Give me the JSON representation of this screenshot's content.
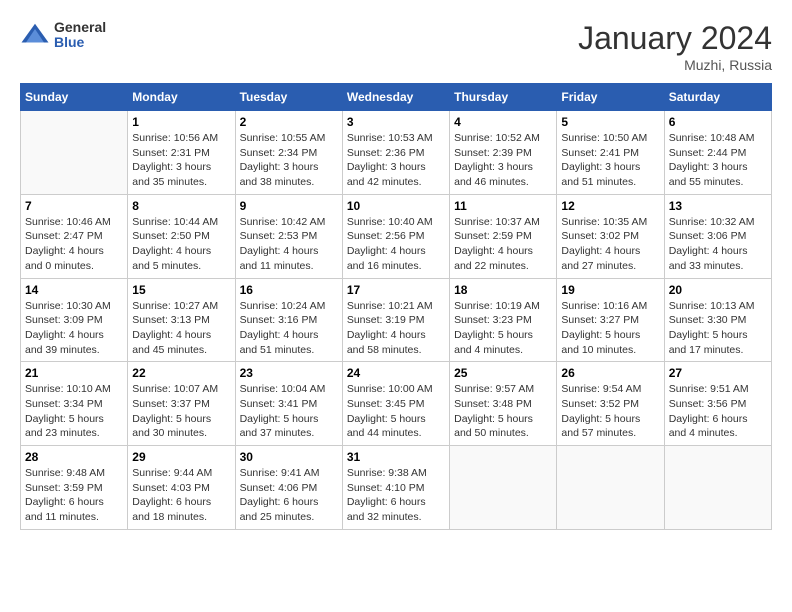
{
  "header": {
    "logo_general": "General",
    "logo_blue": "Blue",
    "title": "January 2024",
    "subtitle": "Muzhi, Russia"
  },
  "days_of_week": [
    "Sunday",
    "Monday",
    "Tuesday",
    "Wednesday",
    "Thursday",
    "Friday",
    "Saturday"
  ],
  "weeks": [
    [
      {
        "day": "",
        "info": ""
      },
      {
        "day": "1",
        "info": "Sunrise: 10:56 AM\nSunset: 2:31 PM\nDaylight: 3 hours\nand 35 minutes."
      },
      {
        "day": "2",
        "info": "Sunrise: 10:55 AM\nSunset: 2:34 PM\nDaylight: 3 hours\nand 38 minutes."
      },
      {
        "day": "3",
        "info": "Sunrise: 10:53 AM\nSunset: 2:36 PM\nDaylight: 3 hours\nand 42 minutes."
      },
      {
        "day": "4",
        "info": "Sunrise: 10:52 AM\nSunset: 2:39 PM\nDaylight: 3 hours\nand 46 minutes."
      },
      {
        "day": "5",
        "info": "Sunrise: 10:50 AM\nSunset: 2:41 PM\nDaylight: 3 hours\nand 51 minutes."
      },
      {
        "day": "6",
        "info": "Sunrise: 10:48 AM\nSunset: 2:44 PM\nDaylight: 3 hours\nand 55 minutes."
      }
    ],
    [
      {
        "day": "7",
        "info": "Sunrise: 10:46 AM\nSunset: 2:47 PM\nDaylight: 4 hours\nand 0 minutes."
      },
      {
        "day": "8",
        "info": "Sunrise: 10:44 AM\nSunset: 2:50 PM\nDaylight: 4 hours\nand 5 minutes."
      },
      {
        "day": "9",
        "info": "Sunrise: 10:42 AM\nSunset: 2:53 PM\nDaylight: 4 hours\nand 11 minutes."
      },
      {
        "day": "10",
        "info": "Sunrise: 10:40 AM\nSunset: 2:56 PM\nDaylight: 4 hours\nand 16 minutes."
      },
      {
        "day": "11",
        "info": "Sunrise: 10:37 AM\nSunset: 2:59 PM\nDaylight: 4 hours\nand 22 minutes."
      },
      {
        "day": "12",
        "info": "Sunrise: 10:35 AM\nSunset: 3:02 PM\nDaylight: 4 hours\nand 27 minutes."
      },
      {
        "day": "13",
        "info": "Sunrise: 10:32 AM\nSunset: 3:06 PM\nDaylight: 4 hours\nand 33 minutes."
      }
    ],
    [
      {
        "day": "14",
        "info": "Sunrise: 10:30 AM\nSunset: 3:09 PM\nDaylight: 4 hours\nand 39 minutes."
      },
      {
        "day": "15",
        "info": "Sunrise: 10:27 AM\nSunset: 3:13 PM\nDaylight: 4 hours\nand 45 minutes."
      },
      {
        "day": "16",
        "info": "Sunrise: 10:24 AM\nSunset: 3:16 PM\nDaylight: 4 hours\nand 51 minutes."
      },
      {
        "day": "17",
        "info": "Sunrise: 10:21 AM\nSunset: 3:19 PM\nDaylight: 4 hours\nand 58 minutes."
      },
      {
        "day": "18",
        "info": "Sunrise: 10:19 AM\nSunset: 3:23 PM\nDaylight: 5 hours\nand 4 minutes."
      },
      {
        "day": "19",
        "info": "Sunrise: 10:16 AM\nSunset: 3:27 PM\nDaylight: 5 hours\nand 10 minutes."
      },
      {
        "day": "20",
        "info": "Sunrise: 10:13 AM\nSunset: 3:30 PM\nDaylight: 5 hours\nand 17 minutes."
      }
    ],
    [
      {
        "day": "21",
        "info": "Sunrise: 10:10 AM\nSunset: 3:34 PM\nDaylight: 5 hours\nand 23 minutes."
      },
      {
        "day": "22",
        "info": "Sunrise: 10:07 AM\nSunset: 3:37 PM\nDaylight: 5 hours\nand 30 minutes."
      },
      {
        "day": "23",
        "info": "Sunrise: 10:04 AM\nSunset: 3:41 PM\nDaylight: 5 hours\nand 37 minutes."
      },
      {
        "day": "24",
        "info": "Sunrise: 10:00 AM\nSunset: 3:45 PM\nDaylight: 5 hours\nand 44 minutes."
      },
      {
        "day": "25",
        "info": "Sunrise: 9:57 AM\nSunset: 3:48 PM\nDaylight: 5 hours\nand 50 minutes."
      },
      {
        "day": "26",
        "info": "Sunrise: 9:54 AM\nSunset: 3:52 PM\nDaylight: 5 hours\nand 57 minutes."
      },
      {
        "day": "27",
        "info": "Sunrise: 9:51 AM\nSunset: 3:56 PM\nDaylight: 6 hours\nand 4 minutes."
      }
    ],
    [
      {
        "day": "28",
        "info": "Sunrise: 9:48 AM\nSunset: 3:59 PM\nDaylight: 6 hours\nand 11 minutes."
      },
      {
        "day": "29",
        "info": "Sunrise: 9:44 AM\nSunset: 4:03 PM\nDaylight: 6 hours\nand 18 minutes."
      },
      {
        "day": "30",
        "info": "Sunrise: 9:41 AM\nSunset: 4:06 PM\nDaylight: 6 hours\nand 25 minutes."
      },
      {
        "day": "31",
        "info": "Sunrise: 9:38 AM\nSunset: 4:10 PM\nDaylight: 6 hours\nand 32 minutes."
      },
      {
        "day": "",
        "info": ""
      },
      {
        "day": "",
        "info": ""
      },
      {
        "day": "",
        "info": ""
      }
    ]
  ]
}
